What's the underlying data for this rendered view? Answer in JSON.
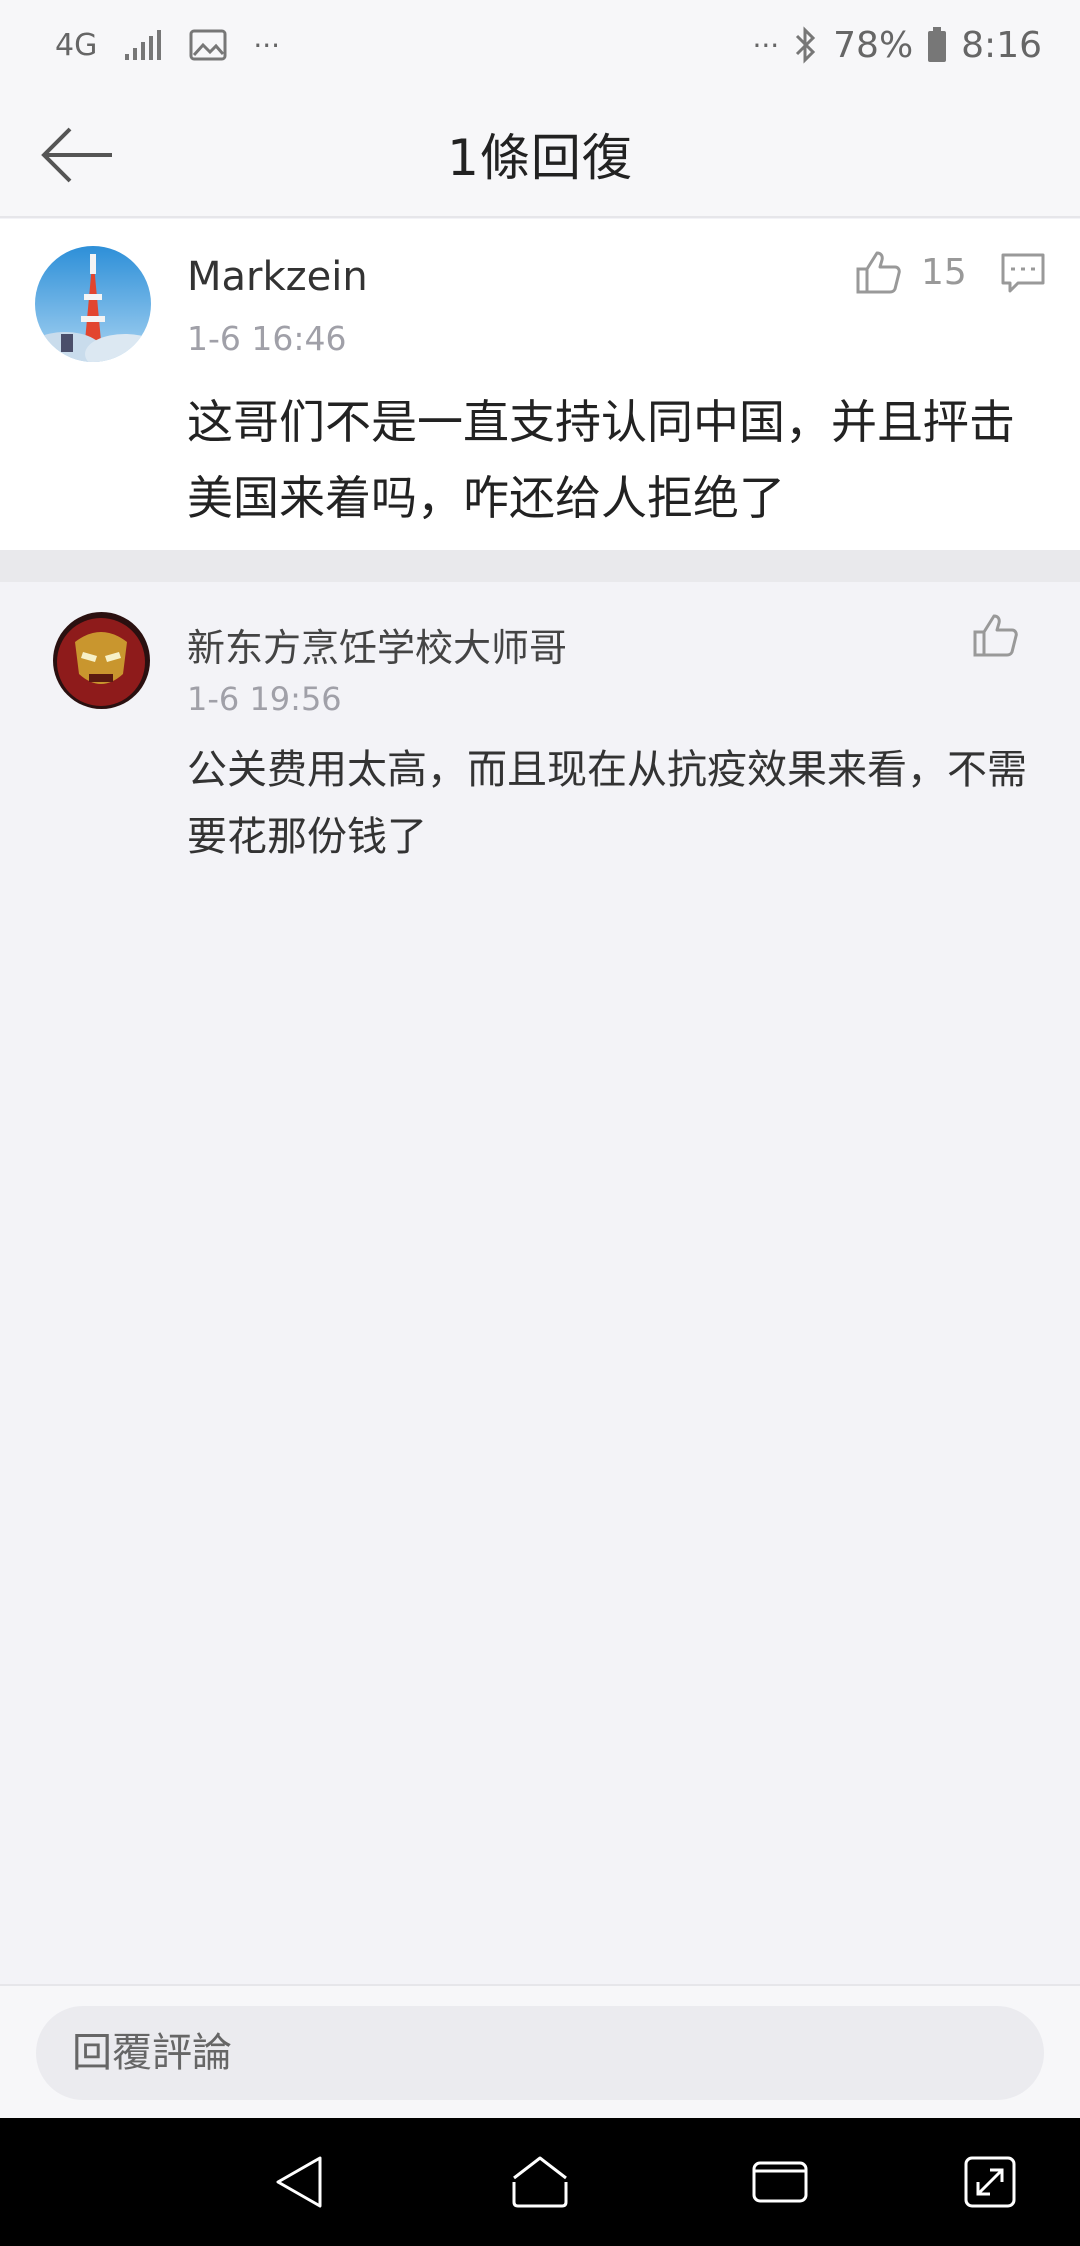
{
  "status_bar": {
    "network": "4G",
    "more_left": "···",
    "more_right": "···",
    "battery": "78%",
    "time": "8:16"
  },
  "header": {
    "title": "1條回復"
  },
  "main_comment": {
    "username": "Markzein",
    "time": "1-6 16:46",
    "likes": "15",
    "text": "这哥们不是一直支持认同中国，并且抨击美国来着吗，咋还给人拒绝了"
  },
  "reply": {
    "username": "新东方烹饪学校大师哥",
    "time": "1-6 19:56",
    "text": "公关费用太高，而且现在从抗疫效果来看，不需要花那份钱了"
  },
  "reply_bar": {
    "placeholder": "回覆評論"
  },
  "icons": {
    "back": "back-arrow-icon",
    "like": "thumbs-up-icon",
    "comment": "comment-icon",
    "nav_back": "triangle-back-icon",
    "nav_home": "home-icon",
    "nav_recents": "recents-icon",
    "nav_expand": "expand-icon"
  },
  "colors": {
    "background": "#f3f3f7",
    "card": "#ffffff",
    "muted_text": "#a0a0a8",
    "nav_bar": "#000000"
  }
}
